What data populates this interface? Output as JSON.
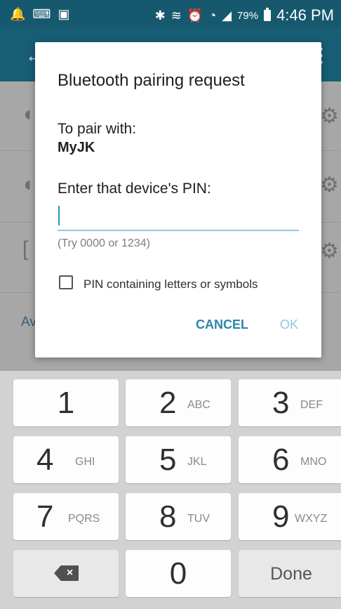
{
  "status_bar": {
    "left_icons": [
      "notification-bell-icon",
      "keyboard-icon",
      "image-icon"
    ],
    "right_icons": [
      "bluetooth-icon",
      "vibrate-icon",
      "alarm-icon",
      "wifi-icon",
      "signal-icon",
      "battery-icon"
    ],
    "battery": "79%",
    "time": "4:46 PM"
  },
  "background_list": {
    "visible_text": "Av"
  },
  "dialog": {
    "title": "Bluetooth pairing request",
    "pair_label": "To pair with:",
    "device_name": "MyJK",
    "pin_prompt": "Enter that device's PIN:",
    "pin_value": "",
    "pin_hint": "(Try 0000 or 1234)",
    "checkbox_label": "PIN containing letters or symbols",
    "checkbox_checked": false,
    "cancel_label": "CANCEL",
    "ok_label": "OK"
  },
  "keyboard": {
    "keys": [
      {
        "number": "1",
        "letters": ""
      },
      {
        "number": "2",
        "letters": "ABC"
      },
      {
        "number": "3",
        "letters": "DEF"
      },
      {
        "number": "4",
        "letters": "GHI"
      },
      {
        "number": "5",
        "letters": "JKL"
      },
      {
        "number": "6",
        "letters": "MNO"
      },
      {
        "number": "7",
        "letters": "PQRS"
      },
      {
        "number": "8",
        "letters": "TUV"
      },
      {
        "number": "9",
        "letters": "WXYZ"
      },
      {
        "number": "0",
        "letters": ""
      }
    ],
    "done_label": "Done"
  },
  "colors": {
    "status_bar": "#16596f",
    "accent": "#2b86a8",
    "input_underline": "#8fc9de",
    "keyboard_bg": "#d2d2d2"
  }
}
